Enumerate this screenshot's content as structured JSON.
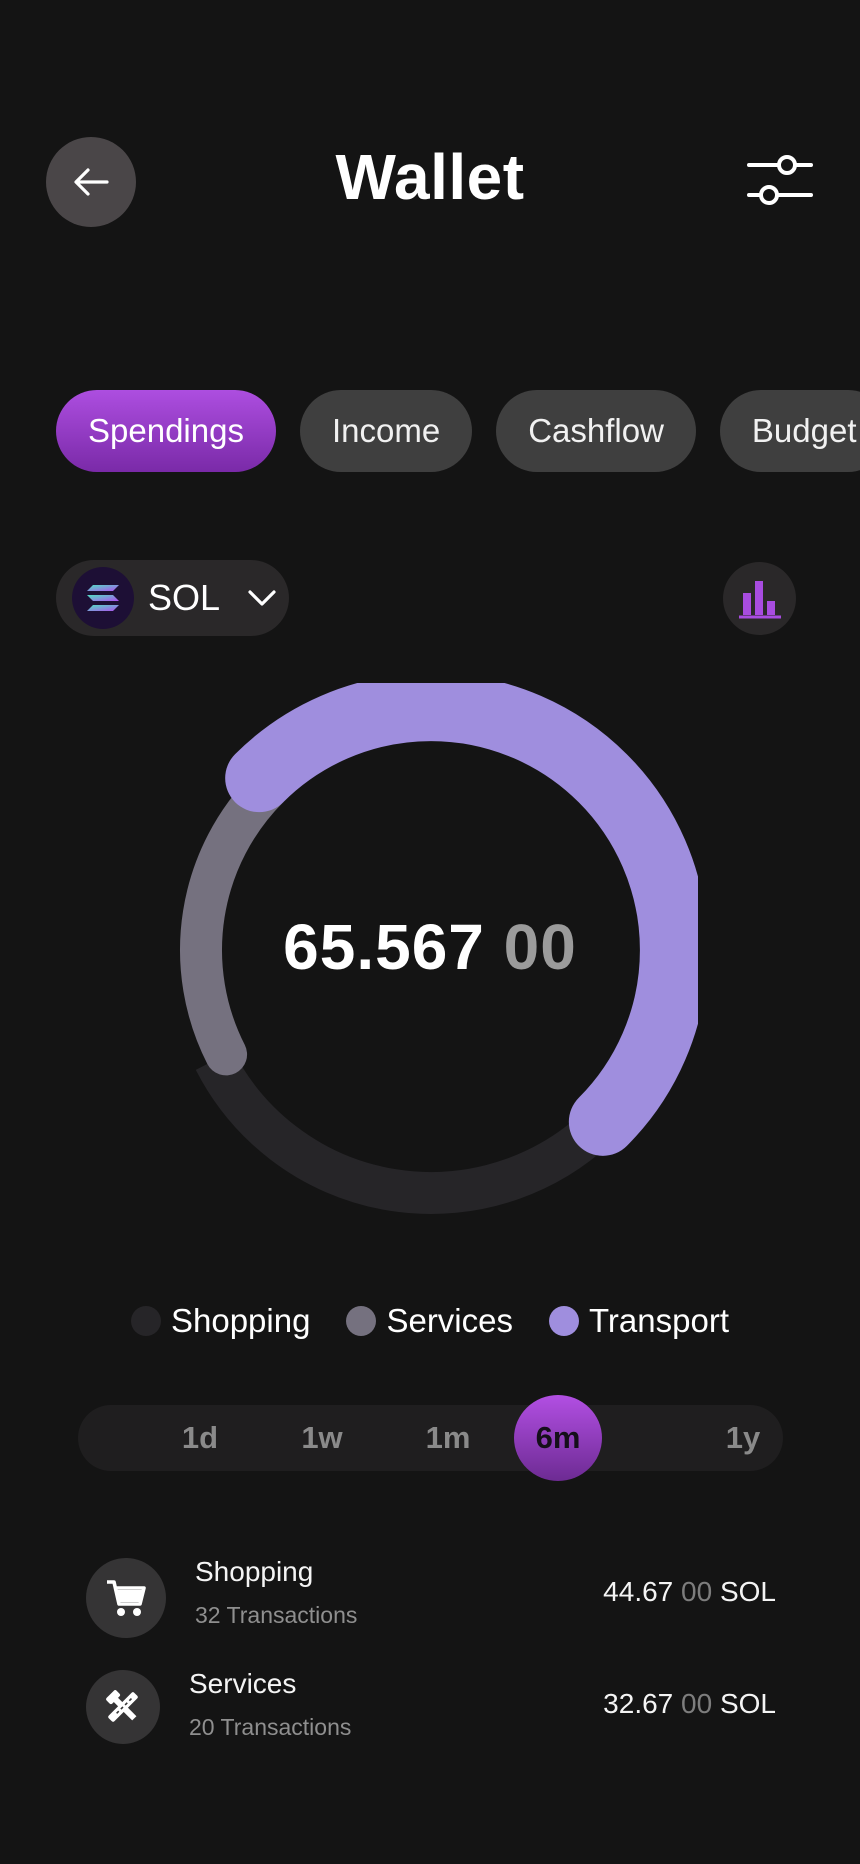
{
  "header": {
    "title": "Wallet",
    "back_icon": "arrow-left-icon",
    "filter_icon": "sliders-icon"
  },
  "tabs": [
    {
      "label": "Spendings",
      "active": true
    },
    {
      "label": "Income",
      "active": false
    },
    {
      "label": "Cashflow",
      "active": false
    },
    {
      "label": "Budget",
      "active": false
    }
  ],
  "currency": {
    "label": "SOL",
    "coin_icon": "solana-icon",
    "dropdown_icon": "chevron-down-icon",
    "chart_icon": "bar-chart-icon"
  },
  "total": {
    "integer": "65.567",
    "decimals": "00"
  },
  "chart_data": {
    "type": "pie",
    "variant": "donut",
    "categories": [
      "Shopping",
      "Services",
      "Transport"
    ],
    "values": [
      30,
      20,
      50
    ],
    "colors": [
      "#262528",
      "#75717f",
      "#9f8ede"
    ]
  },
  "legend": [
    {
      "label": "Shopping",
      "color": "#262528"
    },
    {
      "label": "Services",
      "color": "#75717f"
    },
    {
      "label": "Transport",
      "color": "#9f8ede"
    }
  ],
  "periods": [
    {
      "label": "1d",
      "active": false
    },
    {
      "label": "1w",
      "active": false
    },
    {
      "label": "1m",
      "active": false
    },
    {
      "label": "6m",
      "active": true
    },
    {
      "label": "1y",
      "active": false
    }
  ],
  "transactions": [
    {
      "title": "Shopping",
      "subtitle": "32 Transactions",
      "amount": "44.67",
      "decimals": "00",
      "unit": "SOL",
      "icon": "shopping-cart-icon"
    },
    {
      "title": "Services",
      "subtitle": "20 Transactions",
      "amount": "32.67",
      "decimals": "00",
      "unit": "SOL",
      "icon": "tools-icon"
    }
  ],
  "colors": {
    "background": "#141414",
    "accent": "#a84ce0",
    "transport": "#9f8ede",
    "services": "#75717f",
    "shopping": "#262528"
  }
}
